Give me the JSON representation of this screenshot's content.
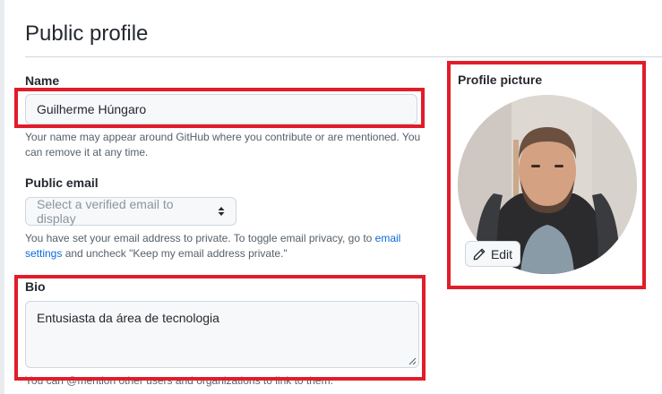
{
  "page": {
    "title": "Public profile"
  },
  "name": {
    "label": "Name",
    "value": "Guilherme Húngaro",
    "note": "Your name may appear around GitHub where you contribute or are mentioned. You can remove it at any time."
  },
  "public_email": {
    "label": "Public email",
    "selected": "Select a verified email to display",
    "note_before": "You have set your email address to private. To toggle email privacy, go to ",
    "note_link": "email settings",
    "note_after": " and uncheck \"Keep my email address private.\""
  },
  "bio": {
    "label": "Bio",
    "value": "Entusiasta da área de tecnologia",
    "note": "You can @mention other users and organizations to link to them."
  },
  "profile_picture": {
    "label": "Profile picture",
    "edit_label": "Edit"
  },
  "colors": {
    "highlight": "#e11d2a",
    "link": "#0969da",
    "muted_text": "#57606a"
  }
}
